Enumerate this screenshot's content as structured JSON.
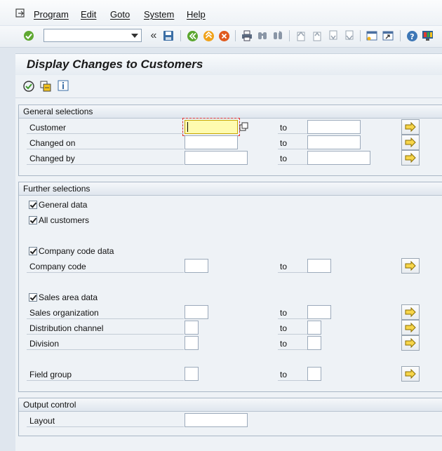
{
  "menubar": {
    "items": [
      {
        "label": "Program"
      },
      {
        "label": "Edit"
      },
      {
        "label": "Goto"
      },
      {
        "label": "System"
      },
      {
        "label": "Help"
      }
    ]
  },
  "toolbar": {
    "command_field_value": "",
    "icons": [
      "enter-icon",
      "back-double-chevron-icon",
      "save-icon",
      "back-icon",
      "exit-icon",
      "cancel-icon",
      "print-icon",
      "find-icon",
      "find-next-icon",
      "first-page-icon",
      "previous-page-icon",
      "next-page-icon",
      "last-page-icon",
      "new-session-icon",
      "shortcut-icon",
      "help-icon",
      "layout-menu-icon"
    ]
  },
  "title": "Display Changes to Customers",
  "app_toolbar": {
    "icons": [
      "execute-icon",
      "get-variant-icon",
      "info-icon"
    ]
  },
  "general_selections": {
    "title": "General selections",
    "rows": [
      {
        "label": "Customer",
        "to": "to",
        "from_value": "",
        "to_value": ""
      },
      {
        "label": "Changed on",
        "to": "to",
        "from_value": "",
        "to_value": ""
      },
      {
        "label": "Changed by",
        "to": "to",
        "from_value": "",
        "to_value": ""
      }
    ]
  },
  "further_selections": {
    "title": "Further selections",
    "general_data": "General data",
    "all_customers": "All customers",
    "company_code_data": "Company code data",
    "company_code": {
      "label": "Company code",
      "to": "to"
    },
    "sales_area_data": "Sales area data",
    "sales_organization": {
      "label": "Sales organization",
      "to": "to"
    },
    "distribution_channel": {
      "label": "Distribution channel",
      "to": "to"
    },
    "division": {
      "label": "Division",
      "to": "to"
    },
    "field_group": {
      "label": "Field group",
      "to": "to"
    }
  },
  "output_control": {
    "title": "Output control",
    "layout": {
      "label": "Layout",
      "value": ""
    }
  }
}
